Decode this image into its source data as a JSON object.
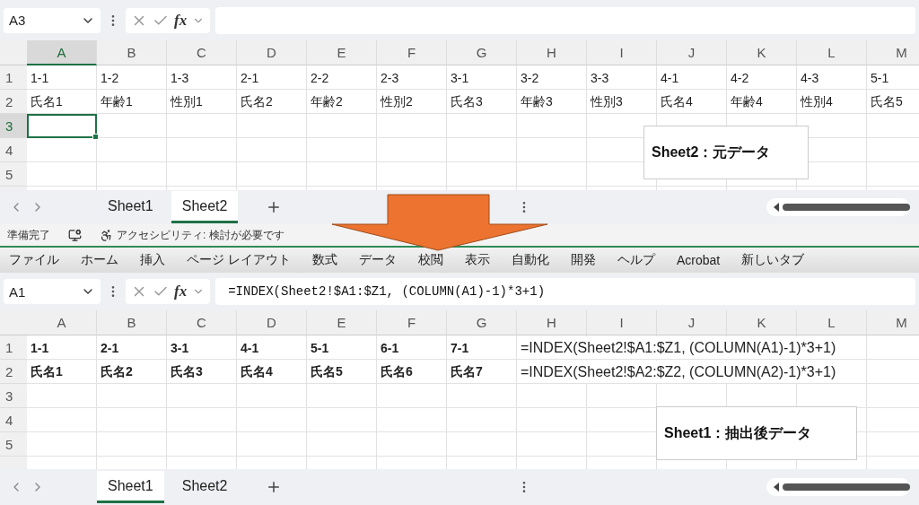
{
  "top_sheet": {
    "name_box": "A3",
    "fx_label": "fx",
    "columns": [
      {
        "label": "A",
        "selected": true
      },
      {
        "label": "B",
        "selected": false
      },
      {
        "label": "C",
        "selected": false
      },
      {
        "label": "D",
        "selected": false
      },
      {
        "label": "E",
        "selected": false
      },
      {
        "label": "F",
        "selected": false
      },
      {
        "label": "G",
        "selected": false
      },
      {
        "label": "H",
        "selected": false
      },
      {
        "label": "I",
        "selected": false
      },
      {
        "label": "J",
        "selected": false
      },
      {
        "label": "K",
        "selected": false
      },
      {
        "label": "L",
        "selected": false
      },
      {
        "label": "M",
        "selected": false
      }
    ],
    "rows": [
      {
        "label": "1",
        "selected": false,
        "cells": [
          {
            "kind": "text",
            "text": "1-1"
          },
          {
            "kind": "text",
            "text": "1-2"
          },
          {
            "kind": "text",
            "text": "1-3"
          },
          {
            "kind": "text",
            "text": "2-1"
          },
          {
            "kind": "text",
            "text": "2-2"
          },
          {
            "kind": "text",
            "text": "2-3"
          },
          {
            "kind": "text",
            "text": "3-1"
          },
          {
            "kind": "text",
            "text": "3-2"
          },
          {
            "kind": "text",
            "text": "3-3"
          },
          {
            "kind": "text",
            "text": "4-1"
          },
          {
            "kind": "text",
            "text": "4-2"
          },
          {
            "kind": "text",
            "text": "4-3"
          },
          {
            "kind": "text",
            "text": "5-1"
          }
        ]
      },
      {
        "label": "2",
        "selected": false,
        "cells": [
          {
            "kind": "text",
            "text": "氏名1"
          },
          {
            "kind": "text",
            "text": "年齢1"
          },
          {
            "kind": "text",
            "text": "性別1"
          },
          {
            "kind": "text",
            "text": "氏名2"
          },
          {
            "kind": "text",
            "text": "年齢2"
          },
          {
            "kind": "text",
            "text": "性別2"
          },
          {
            "kind": "text",
            "text": "氏名3"
          },
          {
            "kind": "text",
            "text": "年齢3"
          },
          {
            "kind": "text",
            "text": "性別3"
          },
          {
            "kind": "text",
            "text": "氏名4"
          },
          {
            "kind": "text",
            "text": "年齢4"
          },
          {
            "kind": "text",
            "text": "性別4"
          },
          {
            "kind": "text",
            "text": "氏名5"
          }
        ]
      },
      {
        "label": "3",
        "selected": true,
        "cells": []
      },
      {
        "label": "4",
        "selected": false,
        "cells": []
      },
      {
        "label": "5",
        "selected": false,
        "cells": []
      }
    ],
    "callout": "Sheet2：元データ",
    "sheet_tabs": [
      {
        "label": "Sheet1",
        "selected": false
      },
      {
        "label": "Sheet2",
        "selected": true
      }
    ],
    "status_bar": {
      "ready": "準備完了",
      "accessibility": "アクセシビリティ: 検討が必要です"
    }
  },
  "bottom_sheet": {
    "ribbon_tabs": [
      "ファイル",
      "ホーム",
      "挿入",
      "ページ レイアウト",
      "数式",
      "データ",
      "校閲",
      "表示",
      "自動化",
      "開発",
      "ヘルプ",
      "Acrobat",
      "新しいタブ"
    ],
    "name_box": "A1",
    "fx_label": "fx",
    "formula": "=INDEX(Sheet2!$A1:$Z1, (COLUMN(A1)-1)*3+1)",
    "columns": [
      {
        "label": "A",
        "selected": false
      },
      {
        "label": "B",
        "selected": false
      },
      {
        "label": "C",
        "selected": false
      },
      {
        "label": "D",
        "selected": false
      },
      {
        "label": "E",
        "selected": false
      },
      {
        "label": "F",
        "selected": false
      },
      {
        "label": "G",
        "selected": false
      },
      {
        "label": "H",
        "selected": false
      },
      {
        "label": "I",
        "selected": false
      },
      {
        "label": "J",
        "selected": false
      },
      {
        "label": "K",
        "selected": false
      },
      {
        "label": "L",
        "selected": false
      },
      {
        "label": "M",
        "selected": false
      }
    ],
    "rows": [
      {
        "label": "1",
        "selected": false,
        "cells": [
          {
            "kind": "bold",
            "text": "1-1"
          },
          {
            "kind": "bold",
            "text": "2-1"
          },
          {
            "kind": "bold",
            "text": "3-1"
          },
          {
            "kind": "bold",
            "text": "4-1"
          },
          {
            "kind": "bold",
            "text": "5-1"
          },
          {
            "kind": "bold",
            "text": "6-1"
          },
          {
            "kind": "bold",
            "text": "7-1"
          },
          {
            "kind": "formula",
            "text": "=INDEX(Sheet2!$A1:$Z1, (COLUMN(A1)-1)*3+1)"
          }
        ]
      },
      {
        "label": "2",
        "selected": false,
        "cells": [
          {
            "kind": "bold",
            "text": "氏名1"
          },
          {
            "kind": "bold",
            "text": "氏名2"
          },
          {
            "kind": "bold",
            "text": "氏名3"
          },
          {
            "kind": "bold",
            "text": "氏名4"
          },
          {
            "kind": "bold",
            "text": "氏名5"
          },
          {
            "kind": "bold",
            "text": "氏名6"
          },
          {
            "kind": "bold",
            "text": "氏名7"
          },
          {
            "kind": "formula",
            "text": "=INDEX(Sheet2!$A2:$Z2, (COLUMN(A2)-1)*3+1)"
          }
        ]
      },
      {
        "label": "3",
        "selected": false,
        "cells": []
      },
      {
        "label": "4",
        "selected": false,
        "cells": []
      },
      {
        "label": "5",
        "selected": false,
        "cells": []
      }
    ],
    "callout": "Sheet1：抽出後データ",
    "sheet_tabs": [
      {
        "label": "Sheet1",
        "selected": true
      },
      {
        "label": "Sheet2",
        "selected": false
      }
    ]
  }
}
